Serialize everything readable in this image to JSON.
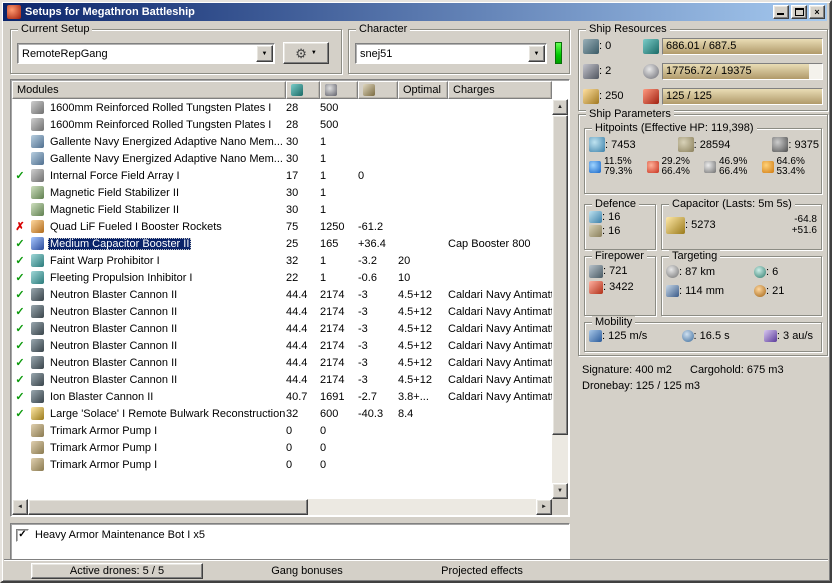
{
  "icons": {
    "close": "×",
    "check": "✓",
    "up": "▲",
    "down": "▼",
    "left": "◄",
    "right": "►",
    "dropdown": "▼",
    "gear": "⚙"
  },
  "window": {
    "title": "Setups for Megathron Battleship"
  },
  "setup_group": {
    "label": "Current Setup",
    "value": "RemoteRepGang"
  },
  "character_group": {
    "label": "Character",
    "value": "snej51"
  },
  "modules": {
    "header": {
      "name": "Modules",
      "optimal": "Optimal",
      "charges": "Charges"
    },
    "status_glyphs": {
      "ok": "✓",
      "error": "✗"
    },
    "rows": [
      {
        "status": "",
        "icon": "armor-plate-icon",
        "name": "1600mm Reinforced Rolled Tungsten Plates I",
        "cpu": "28",
        "pg": "500",
        "cap": "",
        "optimal": "",
        "charges": ""
      },
      {
        "status": "",
        "icon": "armor-plate-icon",
        "name": "1600mm Reinforced Rolled Tungsten Plates I",
        "cpu": "28",
        "pg": "500",
        "cap": "",
        "optimal": "",
        "charges": ""
      },
      {
        "status": "",
        "icon": "nano-membrane-icon",
        "name": "Gallente Navy Energized Adaptive Nano Mem...",
        "cpu": "30",
        "pg": "1",
        "cap": "",
        "optimal": "",
        "charges": ""
      },
      {
        "status": "",
        "icon": "nano-membrane-icon",
        "name": "Gallente Navy Energized Adaptive Nano Mem...",
        "cpu": "30",
        "pg": "1",
        "cap": "",
        "optimal": "",
        "charges": ""
      },
      {
        "status": "ok",
        "icon": "field-array-icon",
        "name": "Internal Force Field Array I",
        "cpu": "17",
        "pg": "1",
        "cap": "0",
        "optimal": "",
        "charges": ""
      },
      {
        "status": "",
        "icon": "mag-stab-icon",
        "name": "Magnetic Field Stabilizer II",
        "cpu": "30",
        "pg": "1",
        "cap": "",
        "optimal": "",
        "charges": ""
      },
      {
        "status": "",
        "icon": "mag-stab-icon",
        "name": "Magnetic Field Stabilizer II",
        "cpu": "30",
        "pg": "1",
        "cap": "",
        "optimal": "",
        "charges": ""
      },
      {
        "status": "error",
        "icon": "booster-rockets-icon",
        "name": "Quad LiF Fueled I Booster Rockets",
        "cpu": "75",
        "pg": "1250",
        "cap": "-61.2",
        "optimal": "",
        "charges": ""
      },
      {
        "status": "ok",
        "icon": "cap-booster-icon",
        "name": "Medium Capacitor Booster II",
        "cpu": "25",
        "pg": "165",
        "cap": "+36.4",
        "optimal": "",
        "charges": "Cap Booster 800",
        "selected": true
      },
      {
        "status": "ok",
        "icon": "warp-scrambler-icon",
        "name": "Faint Warp Prohibitor I",
        "cpu": "32",
        "pg": "1",
        "cap": "-3.2",
        "optimal": "20",
        "charges": ""
      },
      {
        "status": "ok",
        "icon": "stasis-web-icon",
        "name": "Fleeting Propulsion Inhibitor I",
        "cpu": "22",
        "pg": "1",
        "cap": "-0.6",
        "optimal": "10",
        "charges": ""
      },
      {
        "status": "ok",
        "icon": "blaster-icon",
        "name": "Neutron Blaster Cannon II",
        "cpu": "44.4",
        "pg": "2174",
        "cap": "-3",
        "optimal": "4.5+12",
        "charges": "Caldari Navy Antimatter"
      },
      {
        "status": "ok",
        "icon": "blaster-icon",
        "name": "Neutron Blaster Cannon II",
        "cpu": "44.4",
        "pg": "2174",
        "cap": "-3",
        "optimal": "4.5+12",
        "charges": "Caldari Navy Antimatter"
      },
      {
        "status": "ok",
        "icon": "blaster-icon",
        "name": "Neutron Blaster Cannon II",
        "cpu": "44.4",
        "pg": "2174",
        "cap": "-3",
        "optimal": "4.5+12",
        "charges": "Caldari Navy Antimatter"
      },
      {
        "status": "ok",
        "icon": "blaster-icon",
        "name": "Neutron Blaster Cannon II",
        "cpu": "44.4",
        "pg": "2174",
        "cap": "-3",
        "optimal": "4.5+12",
        "charges": "Caldari Navy Antimatter"
      },
      {
        "status": "ok",
        "icon": "blaster-icon",
        "name": "Neutron Blaster Cannon II",
        "cpu": "44.4",
        "pg": "2174",
        "cap": "-3",
        "optimal": "4.5+12",
        "charges": "Caldari Navy Antimatter"
      },
      {
        "status": "ok",
        "icon": "blaster-icon",
        "name": "Neutron Blaster Cannon II",
        "cpu": "44.4",
        "pg": "2174",
        "cap": "-3",
        "optimal": "4.5+12",
        "charges": "Caldari Navy Antimatter"
      },
      {
        "status": "ok",
        "icon": "blaster-icon",
        "name": "Ion Blaster Cannon II",
        "cpu": "40.7",
        "pg": "1691",
        "cap": "-2.7",
        "optimal": "3.8+...",
        "charges": "Caldari Navy Antimatter"
      },
      {
        "status": "ok",
        "icon": "remote-repair-icon",
        "name": "Large 'Solace' I Remote Bulwark Reconstruction",
        "cpu": "32",
        "pg": "600",
        "cap": "-40.3",
        "optimal": "8.4",
        "charges": ""
      },
      {
        "status": "",
        "icon": "armor-rig-icon",
        "name": "Trimark Armor Pump I",
        "cpu": "0",
        "pg": "0",
        "cap": "",
        "optimal": "",
        "charges": ""
      },
      {
        "status": "",
        "icon": "armor-rig-icon",
        "name": "Trimark Armor Pump I",
        "cpu": "0",
        "pg": "0",
        "cap": "",
        "optimal": "",
        "charges": ""
      },
      {
        "status": "",
        "icon": "armor-rig-icon",
        "name": "Trimark Armor Pump I",
        "cpu": "0",
        "pg": "0",
        "cap": "",
        "optimal": "",
        "charges": ""
      }
    ]
  },
  "drones": {
    "items": [
      {
        "checked": true,
        "label": "Heavy Armor Maintenance Bot I x5"
      }
    ]
  },
  "bottom_bar": {
    "active_drones": "Active drones: 5 / 5",
    "gang_bonuses": "Gang bonuses",
    "projected_effects": "Projected effects"
  },
  "ship_resources": {
    "label": "Ship Resources",
    "turrets": "0",
    "launchers": "2",
    "calibration": "250",
    "cpu": "686.01 / 687.5",
    "cpu_pct": 99.8,
    "powergrid": "17756.72 / 19375",
    "powergrid_pct": 91.6,
    "dronebay": "125 / 125",
    "dronebay_pct": 100
  },
  "ship_parameters": {
    "label": "Ship Parameters",
    "hitpoints": {
      "label": "Hitpoints (Effective HP: 119,398)",
      "shield": "7453",
      "armor": "28594",
      "hull": "9375",
      "resists": [
        {
          "shield": "11.5%",
          "armor": "79.3%"
        },
        {
          "shield": "29.2%",
          "armor": "66.4%"
        },
        {
          "shield": "46.9%",
          "armor": "66.4%"
        },
        {
          "shield": "64.6%",
          "armor": "53.4%"
        }
      ]
    },
    "defence": {
      "label": "Defence",
      "shield_rate": "16",
      "armor_rate": "16"
    },
    "capacitor": {
      "label": "Capacitor (Lasts: 5m 5s)",
      "amount": "5273",
      "drain": "-64.8",
      "boost": "+51.6"
    },
    "firepower": {
      "label": "Firepower",
      "dps": "721",
      "volley": "3422"
    },
    "targeting": {
      "label": "Targeting",
      "range": "87 km",
      "max_targets": "6",
      "scan_resolution": "114 mm",
      "sensor_strength": "21"
    },
    "mobility": {
      "label": "Mobility",
      "speed": "125 m/s",
      "align_time": "16.5 s",
      "warp_speed": "3 au/s"
    },
    "signature": "Signature: 400 m2",
    "cargohold": "Cargohold: 675 m3",
    "dronebay": "Dronebay: 125 / 125 m3"
  }
}
